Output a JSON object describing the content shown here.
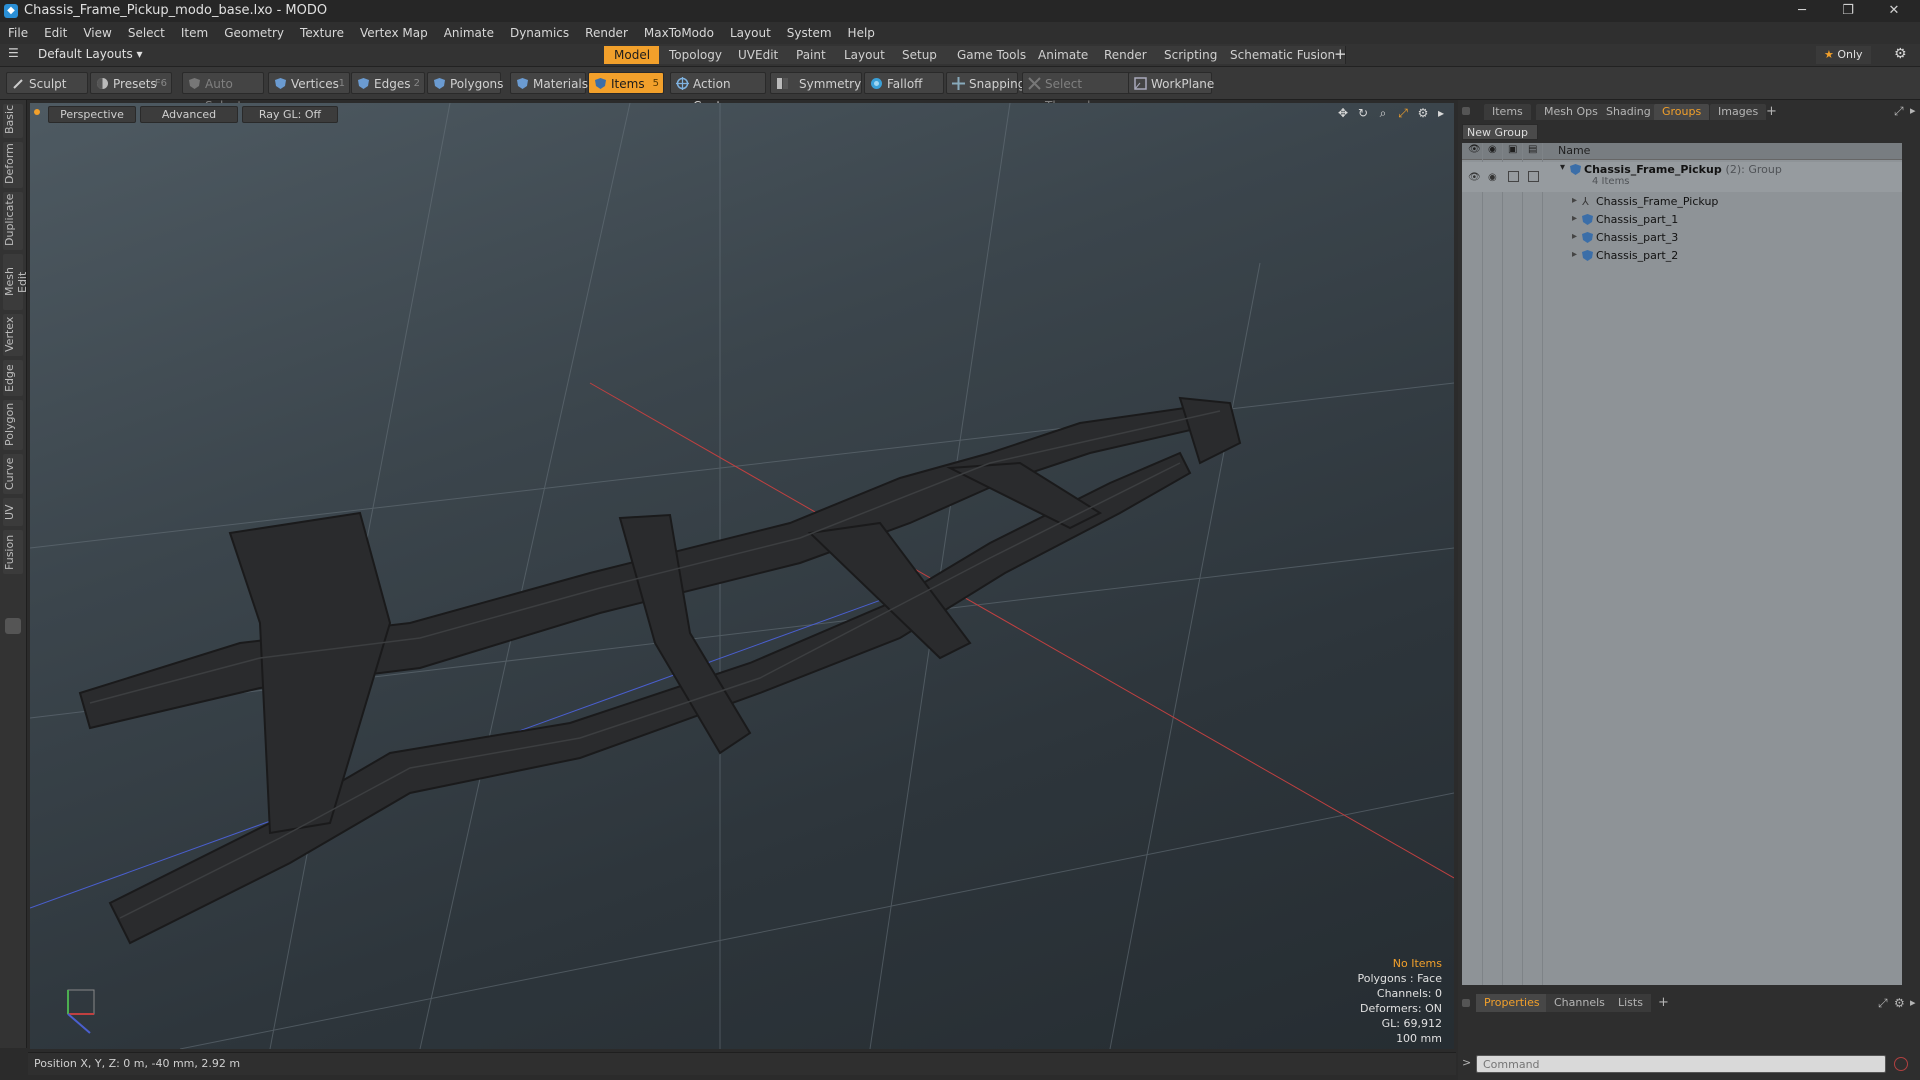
{
  "window": {
    "title": "Chassis_Frame_Pickup_modo_base.lxo - MODO",
    "minimize": "─",
    "restore": "❐",
    "close": "✕"
  },
  "menu": [
    "File",
    "Edit",
    "View",
    "Select",
    "Item",
    "Geometry",
    "Texture",
    "Vertex Map",
    "Animate",
    "Dynamics",
    "Render",
    "MaxToModo",
    "Layout",
    "System",
    "Help"
  ],
  "layout_bar": {
    "layout_name": "Default Layouts",
    "tabs": [
      "Model",
      "Topology",
      "UVEdit",
      "Paint",
      "Layout",
      "Setup",
      "Game Tools",
      "Animate",
      "Render",
      "Scripting",
      "Schematic Fusion"
    ],
    "active_tab": "Model",
    "add": "+",
    "only_label": "Only"
  },
  "toolbar": {
    "sculpt": "Sculpt",
    "presets": "Presets",
    "presets_key": "F6",
    "auto_select": "Auto Select",
    "vertices": "Vertices",
    "vertices_key": "1",
    "edges": "Edges",
    "edges_key": "2",
    "polygons": "Polygons",
    "materials": "Materials",
    "items": "Items",
    "items_key": "5",
    "action_center": "Action Center",
    "symmetry": "Symmetry",
    "falloff": "Falloff",
    "snapping": "Snapping",
    "select_through": "Select Through",
    "workplane": "WorkPlane"
  },
  "left_tabs": [
    "Basic",
    "Deform",
    "Duplicate",
    "Mesh Edit",
    "Vertex",
    "Edge",
    "Polygon",
    "Curve",
    "UV",
    "Fusion"
  ],
  "viewport": {
    "view": "Perspective",
    "shading": "Advanced",
    "raygl": "Ray GL: Off",
    "info": {
      "selection": "No Items",
      "polygons": "Polygons : Face",
      "channels": "Channels: 0",
      "deformers": "Deformers: ON",
      "gl": "GL: 69,912",
      "scale": "100 mm"
    },
    "accent_color": "#f2a02b"
  },
  "status": {
    "position": "Position X, Y, Z:  0 m, -40 mm, 2.92 m"
  },
  "right_panel": {
    "tabs": [
      "Items",
      "Mesh Ops",
      "Shading",
      "Groups",
      "Images"
    ],
    "active_tab": "Groups",
    "add": "+",
    "new_group": "New Group",
    "column_name": "Name",
    "group": {
      "name": "Chassis_Frame_Pickup",
      "count": "(2)",
      "type": ": Group",
      "items_count": "4 Items"
    },
    "children": [
      "Chassis_Frame_Pickup",
      "Chassis_part_1",
      "Chassis_part_3",
      "Chassis_part_2"
    ],
    "bottom_tabs": [
      "Properties",
      "Channels",
      "Lists"
    ],
    "bottom_active": "Properties",
    "command_placeholder": "Command"
  }
}
